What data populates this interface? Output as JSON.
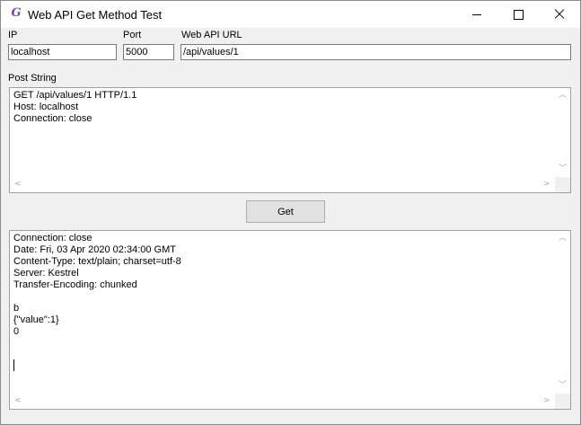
{
  "window": {
    "title": "Web API Get Method Test",
    "icon": "app-g-icon"
  },
  "labels": {
    "ip": "IP",
    "port": "Port",
    "url": "Web API URL",
    "post_string": "Post String"
  },
  "fields": {
    "ip_value": "localhost",
    "port_value": "5000",
    "url_value": "/api/values/1"
  },
  "post_string": {
    "lines": "GET /api/values/1 HTTP/1.1\nHost: localhost\nConnection: close"
  },
  "get_button_label": "Get",
  "response": {
    "lines": "Connection: close\nDate: Fri, 03 Apr 2020 02:34:00 GMT\nContent-Type: text/plain; charset=utf-8\nServer: Kestrel\nTransfer-Encoding: chunked\n\nb\n{\"value\":1}\n0"
  }
}
